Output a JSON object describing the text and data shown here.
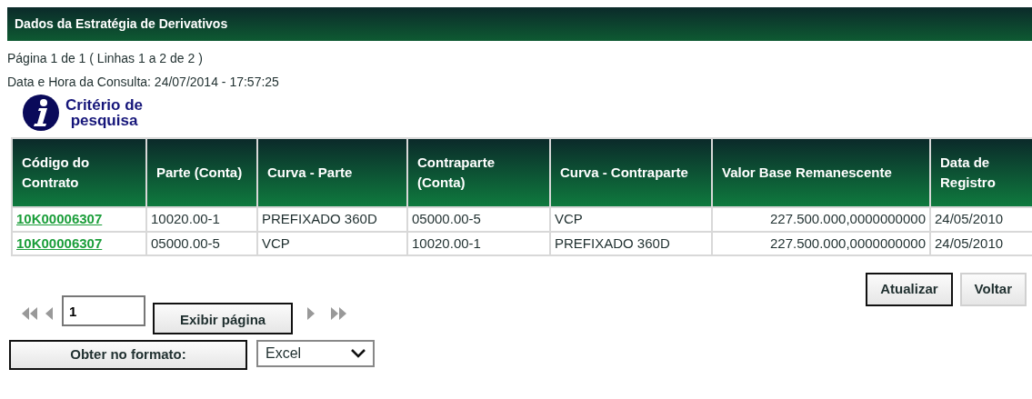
{
  "panel": {
    "title": "Dados da Estratégia de Derivativos"
  },
  "page_info": "Página 1 de 1 ( Linhas 1 a 2 de 2 )",
  "query_time": "Data e Hora da Consulta: 24/07/2014 - 17:57:25",
  "search_criteria_link": [
    "Critério de",
    "pesquisa"
  ],
  "table": {
    "columns": [
      "Código do Contrato",
      "Parte (Conta)",
      "Curva - Parte",
      "Contraparte (Conta)",
      "Curva - Contraparte",
      "Valor Base Remanescente",
      "Data de Registro"
    ],
    "rows": [
      [
        "10K00006307",
        "10020.00-1",
        "PREFIXADO 360D",
        "05000.00-5",
        "VCP",
        "227.500.000,0000000000",
        "24/05/2010"
      ],
      [
        "10K00006307",
        "05000.00-5",
        "VCP",
        "10020.00-1",
        "PREFIXADO 360D",
        "227.500.000,0000000000",
        "24/05/2010"
      ]
    ]
  },
  "actions": [
    {
      "label": "Atualizar",
      "kind": "primary"
    },
    {
      "label": "Voltar",
      "kind": "secondary"
    }
  ],
  "pager": {
    "page_value": "1",
    "go_button": "Exibir página"
  },
  "export": {
    "button": "Obter no formato:",
    "format_value": "Excel"
  }
}
